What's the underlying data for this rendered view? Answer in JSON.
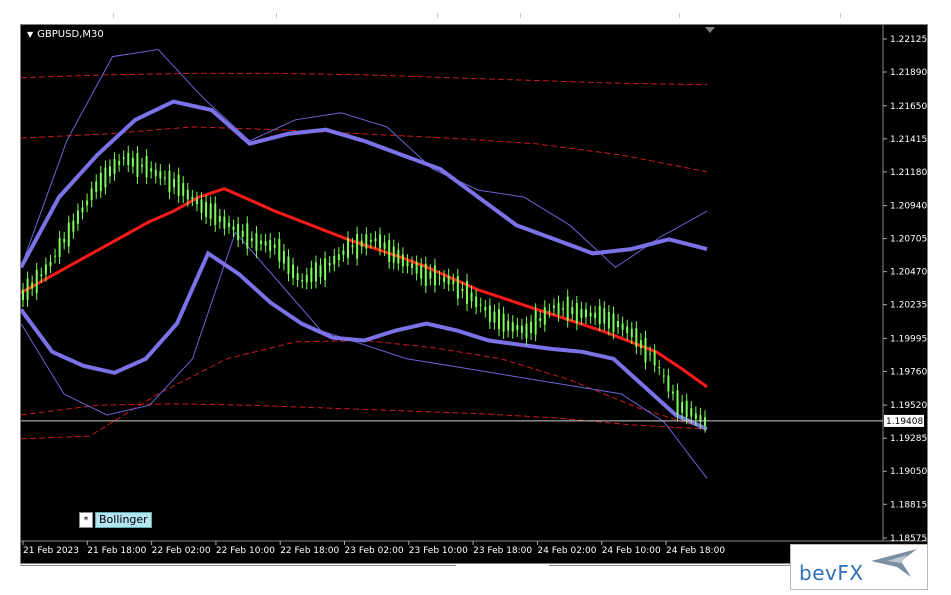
{
  "window": {
    "symbol_label": "GBPUSD,M30",
    "indicator_label": "Bollinger",
    "indicator_star": "*"
  },
  "logo": {
    "text": "bevFX"
  },
  "colors": {
    "background": "#000000",
    "candles": "#7CFC5A",
    "ma_red": "#ff1a1a",
    "band_purple": "#7b72e8",
    "band_thin": "#6a63d8",
    "dashed_red": "#c81a1a",
    "grid_text": "#ffffff"
  },
  "chart_data": {
    "type": "line",
    "title": "GBPUSD,M30",
    "xlabel": "",
    "ylabel": "",
    "ylim": [
      1.18575,
      1.22125
    ],
    "y_ticks": [
      "1.22125",
      "1.21890",
      "1.21650",
      "1.21415",
      "1.21180",
      "1.20940",
      "1.20705",
      "1.20470",
      "1.20235",
      "1.19995",
      "1.19760",
      "1.19520",
      "1.19285",
      "1.19050",
      "1.18815",
      "1.18575"
    ],
    "current_price": "1.19408",
    "x_tick_labels": [
      "21 Feb 2023",
      "21 Feb 18:00",
      "22 Feb 02:00",
      "22 Feb 10:00",
      "22 Feb 18:00",
      "23 Feb 02:00",
      "23 Feb 10:00",
      "23 Feb 18:00",
      "24 Feb 02:00",
      "24 Feb 10:00",
      "24 Feb 18:00"
    ],
    "series": [
      {
        "values": [
          1.203,
          1.205,
          1.208,
          1.211,
          1.2128,
          1.212,
          1.211,
          1.2095,
          1.2082,
          1.207,
          1.2065,
          1.204,
          1.205,
          1.2065,
          1.207,
          1.2055,
          1.2045,
          1.204,
          1.2025,
          1.201,
          1.2005,
          1.2022,
          1.2018,
          1.2015,
          1.2005,
          1.1985,
          1.1952,
          1.194
        ]
      },
      {
        "values": [
          1.2032,
          1.2042,
          1.2052,
          1.2062,
          1.2072,
          1.2082,
          1.209,
          1.21,
          1.2106,
          1.2098,
          1.209,
          1.2083,
          1.2076,
          1.2069,
          1.2063,
          1.2057,
          1.205,
          1.2042,
          1.2034,
          1.2028,
          1.2022,
          1.2016,
          1.201,
          1.2004,
          1.1997,
          1.199,
          1.1978,
          1.1965
        ]
      },
      {
        "values": [
          1.205,
          1.21,
          1.213,
          1.2155,
          1.2168,
          1.2162,
          1.2138,
          1.2145,
          1.2148,
          1.214,
          1.213,
          1.212,
          1.21,
          1.208,
          1.207,
          1.206,
          1.2063,
          1.207,
          1.2063
        ]
      },
      {
        "values": [
          1.202,
          1.199,
          1.198,
          1.1975,
          1.1985,
          1.201,
          1.206,
          1.2045,
          1.2025,
          1.201,
          1.2,
          1.1998,
          1.2005,
          1.201,
          1.2005,
          1.1998,
          1.1995,
          1.1992,
          1.199,
          1.1985,
          1.1965,
          1.1945,
          1.1935
        ]
      }
    ]
  }
}
